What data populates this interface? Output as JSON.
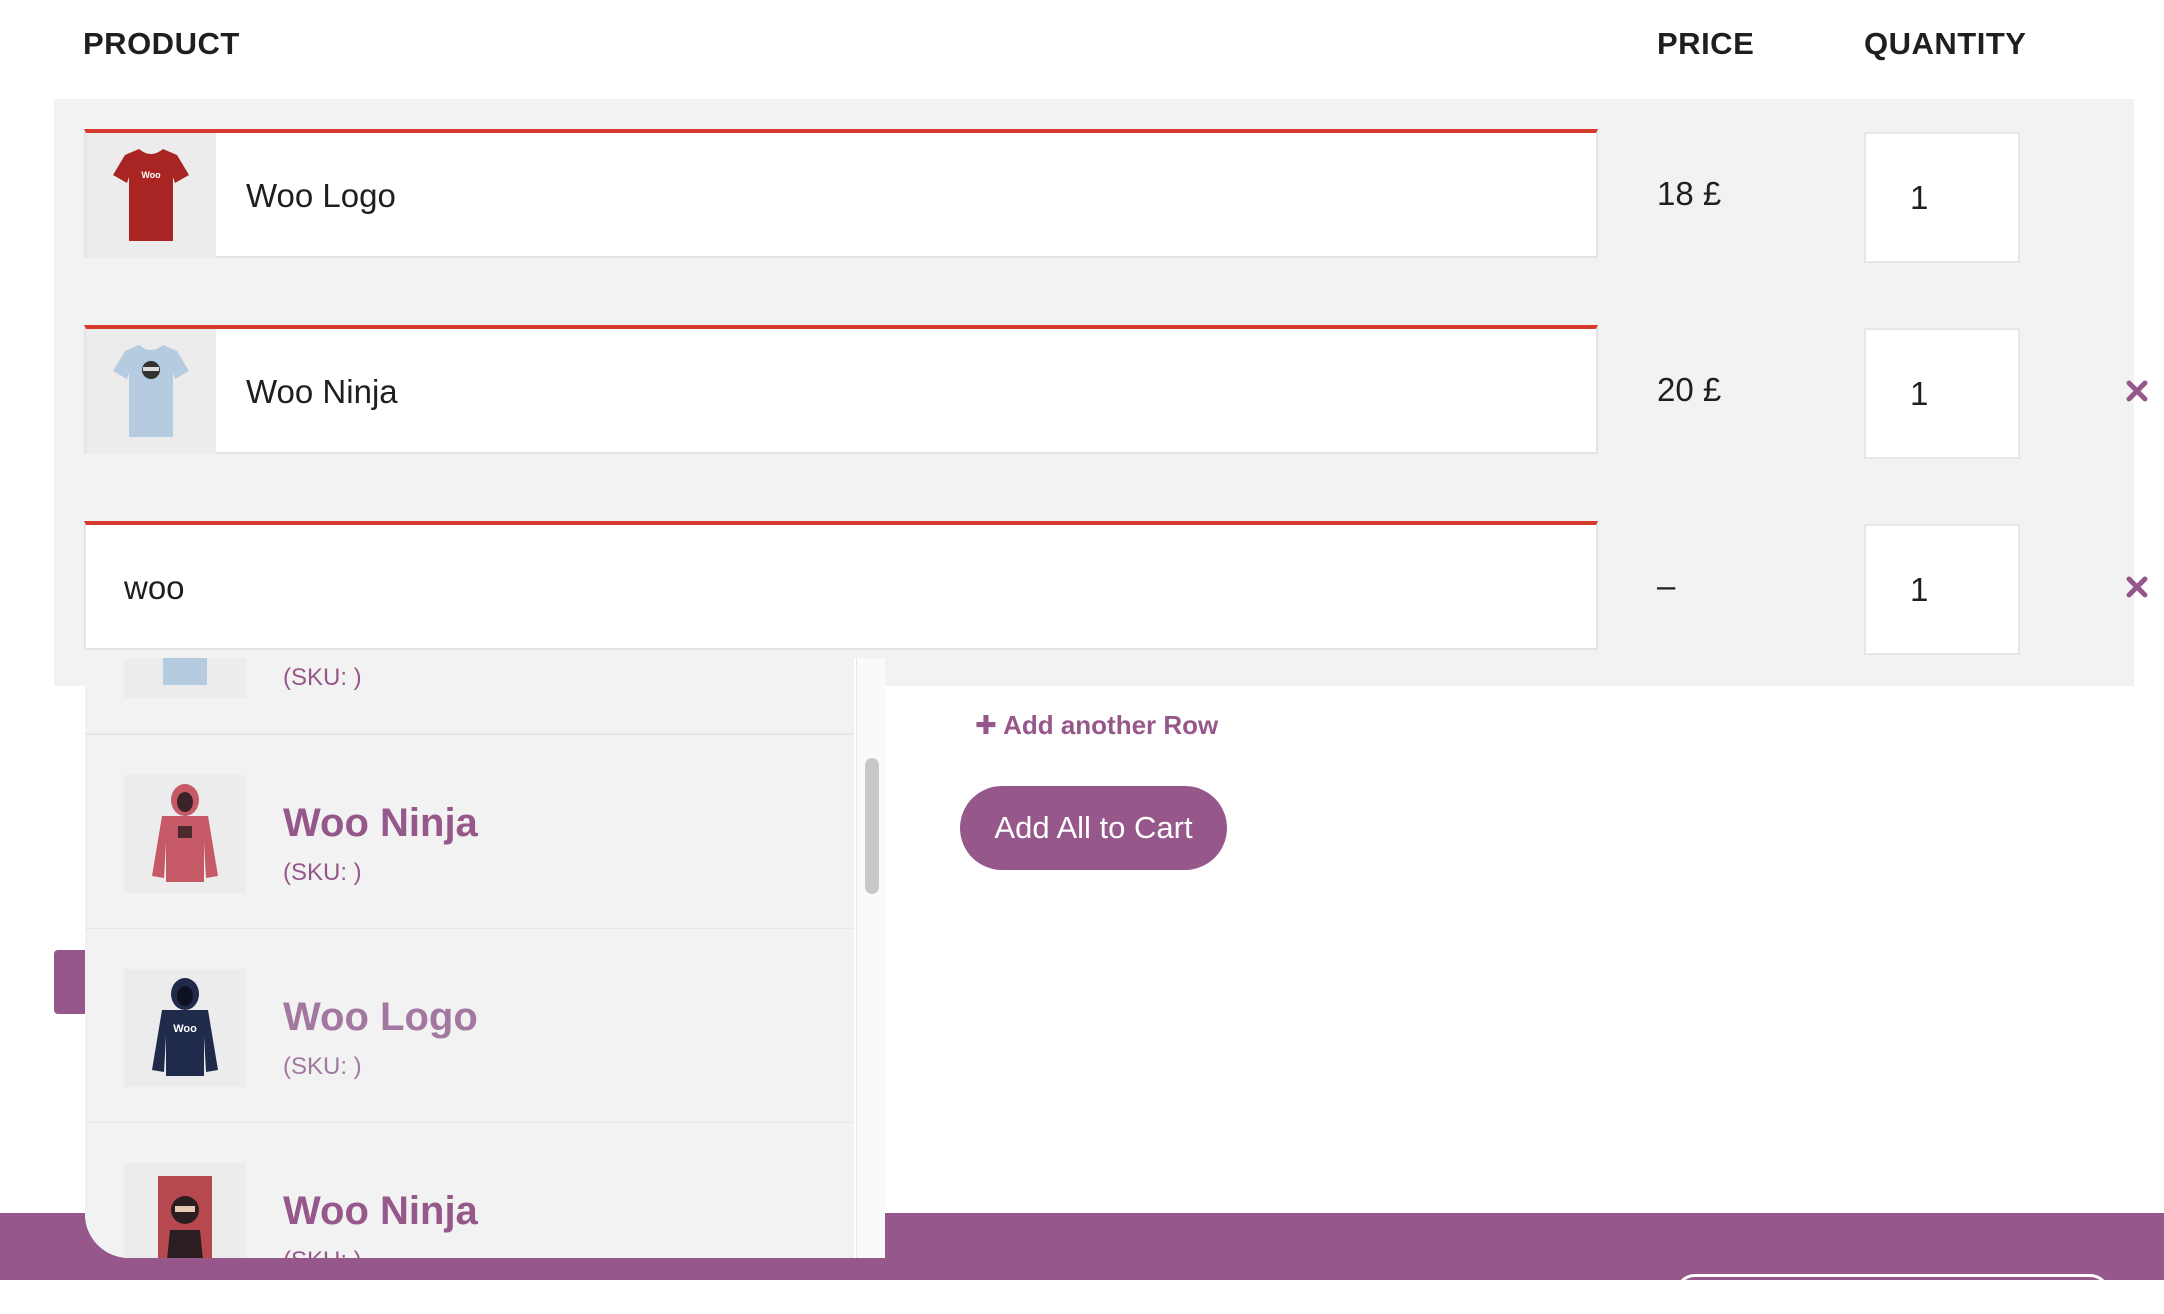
{
  "header": {
    "product": "PRODUCT",
    "price": "PRICE",
    "quantity": "QUANTITY"
  },
  "rows": [
    {
      "product": "Woo Logo",
      "price": "18 £",
      "quantity": "1",
      "thumb": "red-tshirt-woo-logo",
      "removable": false
    },
    {
      "product": "Woo Ninja",
      "price": "20 £",
      "quantity": "1",
      "thumb": "blue-tshirt-ninja",
      "removable": true
    },
    {
      "search": "woo",
      "price": "–",
      "quantity": "1",
      "removable": true
    }
  ],
  "actions": {
    "add_row": "Add another Row",
    "add_all": "Add All to Cart"
  },
  "dropdown": {
    "partial_sku": "(SKU: )",
    "items": [
      {
        "name": "Woo Ninja",
        "sku": "(SKU: )",
        "thumb": "pink-hoodie-ninja"
      },
      {
        "name": "Woo Logo",
        "sku": "(SKU: )",
        "thumb": "navy-hoodie-woo"
      },
      {
        "name": "Woo Ninja",
        "sku": "(SKU: )",
        "thumb": "ninja-poster"
      }
    ]
  },
  "colors": {
    "accent": "#96588a",
    "error_border": "#d93a2e",
    "row_bg": "#f2f2f2"
  }
}
